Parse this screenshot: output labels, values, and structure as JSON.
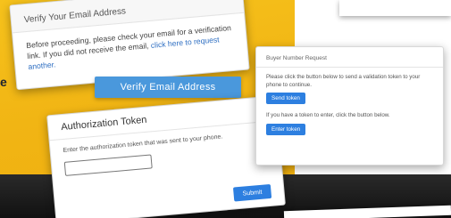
{
  "background": {
    "stray_letter": "e"
  },
  "verify_card": {
    "title": "Verify Your Email Address",
    "body_text": "Before proceeding, please check your email for a verification link. If you did not receive the email,",
    "request_link": "click here to request another.",
    "verify_button": "Verify Email Address"
  },
  "auth_card": {
    "title": "Authorization Token",
    "instruction": "Enter the authorization token that was sent to your phone.",
    "input_value": "",
    "submit_button": "Submit"
  },
  "phone_card": {
    "title": "Buyer Number Request",
    "send_text": "Please click the button below to send a validation token to your phone to continue.",
    "send_button": "Send token",
    "enter_text": "If you have a token to enter, click the button below.",
    "enter_button": "Enter token"
  },
  "colors": {
    "accent_yellow": "#f1b514",
    "primary_blue": "#2d7fe0",
    "verify_blue": "#4a98dc",
    "link_blue": "#2f6fc2"
  }
}
